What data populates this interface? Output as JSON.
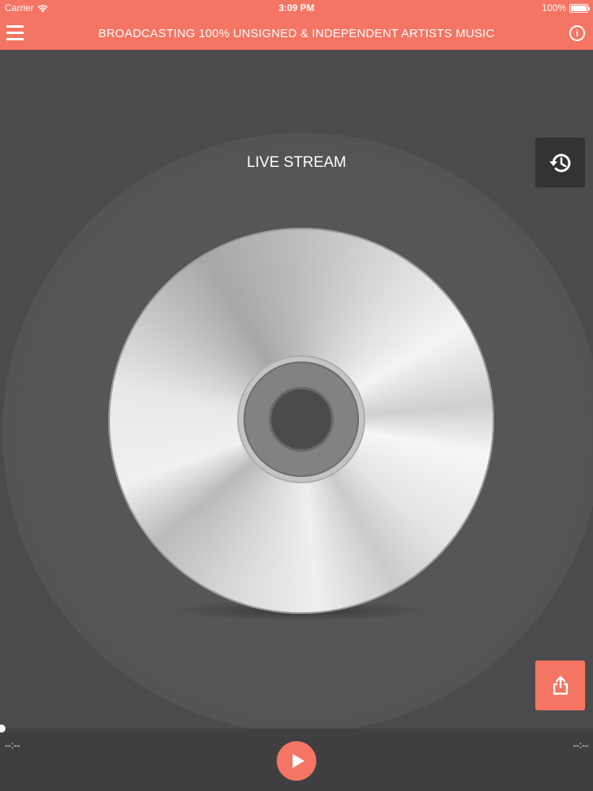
{
  "status_bar": {
    "carrier": "Carrier",
    "time": "3:09 PM",
    "battery": "100%",
    "battery_level": 1.0
  },
  "nav": {
    "title": "BROADCASTING 100% UNSIGNED & INDEPENDENT ARTISTS MUSIC",
    "menu_icon": "hamburger-menu-icon",
    "info_icon": "info-icon",
    "info_symbol": "i"
  },
  "main": {
    "stream_title": "LIVE STREAM",
    "history_icon": "history-icon",
    "share_icon": "share-icon"
  },
  "player": {
    "elapsed": "--:--",
    "remaining": "--:--",
    "progress": 0,
    "play_icon": "play-icon"
  },
  "colors": {
    "accent": "#f47563",
    "background": "#4b4b4d",
    "player_bar": "#3f3f41",
    "history_button": "#333335",
    "text": "#ffffff"
  }
}
